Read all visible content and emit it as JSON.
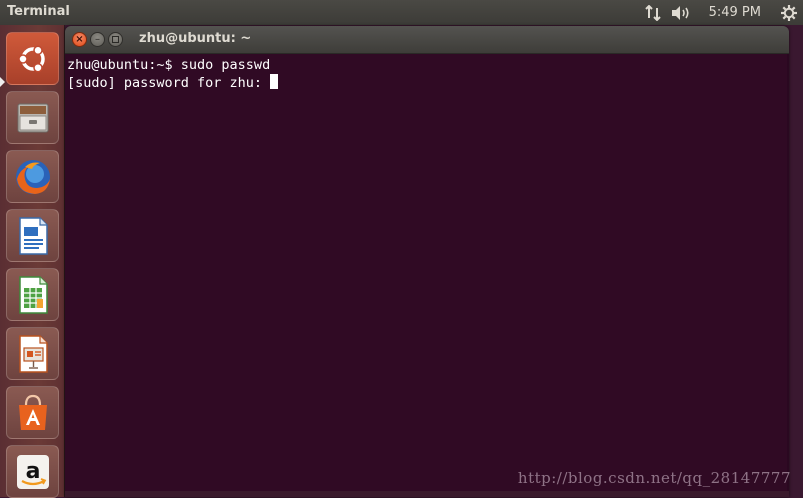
{
  "top_panel": {
    "app_title": "Terminal",
    "clock": "5:49 PM",
    "icons": [
      "network-icon",
      "volume-icon",
      "gear-icon"
    ]
  },
  "launcher": {
    "items": [
      {
        "name": "ubuntu-dash",
        "icon": "ubuntu-logo-icon",
        "active": true
      },
      {
        "name": "files",
        "icon": "file-cabinet-icon"
      },
      {
        "name": "firefox",
        "icon": "firefox-icon"
      },
      {
        "name": "libreoffice-writer",
        "icon": "writer-document-icon"
      },
      {
        "name": "libreoffice-calc",
        "icon": "calc-spreadsheet-icon"
      },
      {
        "name": "libreoffice-impress",
        "icon": "impress-presentation-icon"
      },
      {
        "name": "ubuntu-software-center",
        "icon": "shopping-bag-icon"
      },
      {
        "name": "amazon",
        "icon": "amazon-icon"
      }
    ]
  },
  "window": {
    "title": "zhu@ubuntu: ~",
    "lines": [
      "zhu@ubuntu:~$ sudo passwd",
      "[sudo] password for zhu: "
    ]
  },
  "watermark": "http://blog.csdn.net/qq_28147777",
  "colors": {
    "terminal_bg": "#300a24",
    "panel_bg": "#3c3b37",
    "close_button": "#df4a16",
    "launcher_active": "#d05a3a"
  }
}
